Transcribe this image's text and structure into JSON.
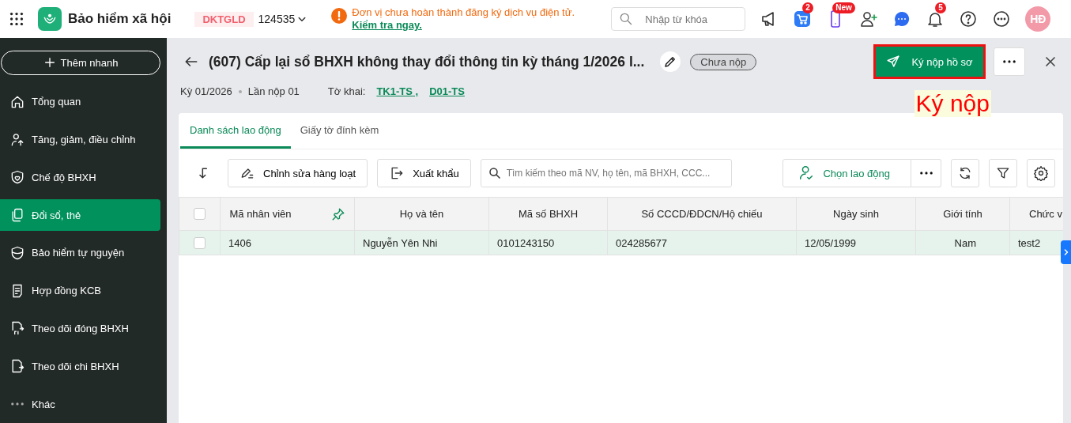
{
  "topbar": {
    "app_title": "Bảo hiểm xã hội",
    "company_code": "DKTGLD",
    "company_id": "124535",
    "notice": {
      "text": "Đơn vị chưa hoàn thành đăng ký dịch vụ điện tử.",
      "link": "Kiểm tra ngay."
    },
    "search": {
      "placeholder": "Nhập từ khóa"
    },
    "cart_badge": "2",
    "phone_badge": "New",
    "bell_badge": "5",
    "avatar": "HĐ"
  },
  "sidebar": {
    "quick_add": "Thêm nhanh",
    "items": [
      {
        "label": "Tổng quan",
        "selected": false
      },
      {
        "label": "Tăng, giảm, điều chỉnh",
        "selected": false
      },
      {
        "label": "Chế độ BHXH",
        "selected": false
      },
      {
        "label": "Đổi sổ, thẻ",
        "selected": true
      },
      {
        "label": "Bảo hiểm tự nguyện",
        "selected": false
      },
      {
        "label": "Hợp đồng KCB",
        "selected": false
      },
      {
        "label": "Theo dõi đóng BHXH",
        "selected": false
      },
      {
        "label": "Theo dõi chi BHXH",
        "selected": false
      },
      {
        "label": "Khác",
        "selected": false
      }
    ]
  },
  "header": {
    "title": "(607) Cấp lại sổ BHXH không thay đổi thông tin kỳ tháng 1/2026 l...",
    "status": "Chưa nộp",
    "period": "Kỳ 01/2026",
    "submission": "Lần nộp 01",
    "forms_label": "Tờ khai:",
    "forms": [
      "TK1-TS ,",
      "D01-TS"
    ],
    "primary_button": "Ký nộp hồ sơ",
    "annotation": "Ký nộp"
  },
  "tabs": [
    {
      "label": "Danh sách lao động",
      "selected": true
    },
    {
      "label": "Giấy tờ đính kèm",
      "selected": false
    }
  ],
  "toolbar": {
    "bulk_edit": "Chỉnh sửa hàng loạt",
    "export": "Xuất khẩu",
    "search": {
      "placeholder": "Tìm kiếm theo mã NV, họ tên, mã BHXH, CCC..."
    },
    "choose_employee": "Chọn lao động"
  },
  "table": {
    "all_checked": false,
    "columns": [
      "Mã nhân viên",
      "Họ và tên",
      "Mã số BHXH",
      "Số CCCD/ĐDCN/Hộ chiếu",
      "Ngày sinh",
      "Giới tính",
      "Chức v"
    ],
    "rows": [
      {
        "selected": true,
        "checked": false,
        "cells": [
          "1406",
          "Nguyễn Yên Nhi",
          "0101243150",
          "024285677",
          "12/05/1999",
          "Nam",
          "test2"
        ]
      }
    ]
  }
}
